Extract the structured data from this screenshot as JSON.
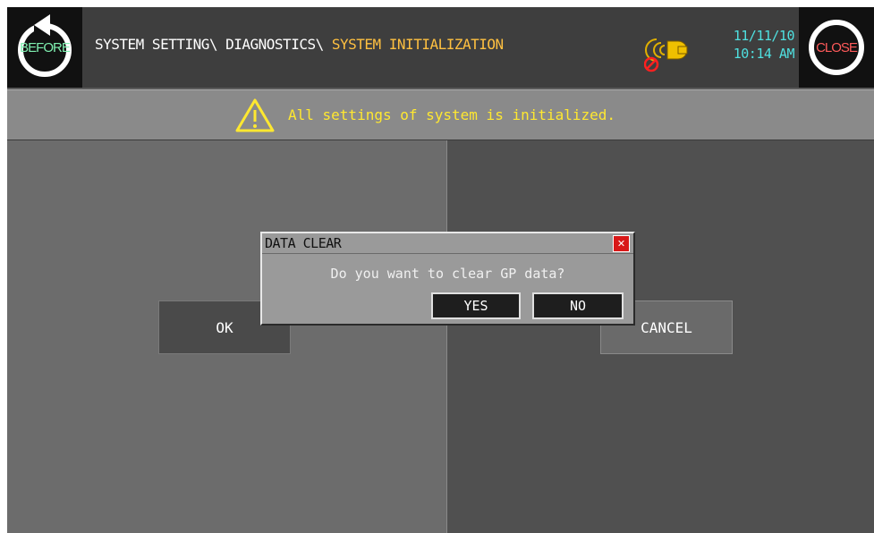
{
  "header": {
    "back_label": "BEFORE",
    "close_label": "CLOSE",
    "breadcrumb_path": "SYSTEM SETTING\\ DIAGNOSTICS\\ ",
    "breadcrumb_current": "SYSTEM INITIALIZATION",
    "date": "11/11/10",
    "time": "10:14 AM",
    "buzzer_icon": "buzzer-muted-icon"
  },
  "warning": {
    "icon": "warning-icon",
    "text": "All settings of system is initialized."
  },
  "panels": {
    "ok_label": "OK",
    "cancel_label": "CANCEL"
  },
  "dialog": {
    "title": "DATA CLEAR",
    "close_icon": "close-icon",
    "message": "Do you want to clear GP data?",
    "yes_label": "YES",
    "no_label": "NO"
  },
  "colors": {
    "breadcrumb_current": "#ffc040",
    "warning_text": "#ffe830",
    "datetime": "#4fe0e0",
    "dialog_close": "#d81818"
  }
}
